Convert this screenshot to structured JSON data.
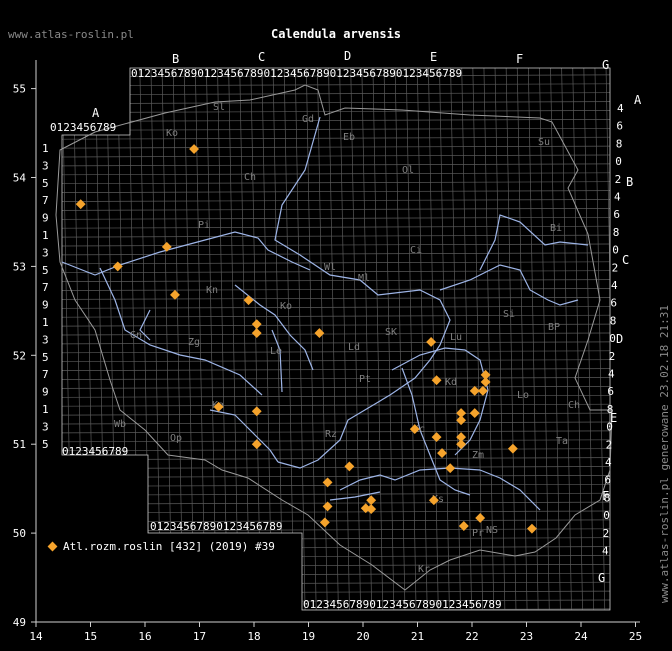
{
  "site": "www.atlas-roslin.pl",
  "title": "Calendula arvensis",
  "credit": "www.atlas-roslin.pl generowane 23.02.18 21:31",
  "legend_label": "Atl.rozm.roslin [432] (2019) #39",
  "colors": {
    "background": "#000000",
    "grid": "#5a5a5a",
    "border": "#9a9a9a",
    "rivers": "#9db4e6",
    "points": "#f5a32c",
    "text": "#ffffff"
  },
  "axes": {
    "x_ticks": [
      "14",
      "15",
      "16",
      "17",
      "18",
      "19",
      "20",
      "21",
      "22",
      "23",
      "24",
      "25"
    ],
    "y_ticks": [
      "49",
      "50",
      "51",
      "52",
      "53",
      "54",
      "55"
    ]
  },
  "grid_letters_top": [
    "A",
    "B",
    "C",
    "D",
    "E",
    "F",
    "G"
  ],
  "grid_letters_right": [
    "A",
    "B",
    "C",
    "D",
    "E",
    "F",
    "G"
  ],
  "grid_digits": "0123456789",
  "region_labels": [
    "Sl",
    "Gd",
    "Eb",
    "Ko",
    "Su",
    "Ol",
    "Ch",
    "Pi",
    "Bi",
    "Ci",
    "Wl",
    "Ml",
    "Kn",
    "Ko",
    "Gn",
    "Zg",
    "Le",
    "Lu",
    "Pt",
    "SK",
    "Ld",
    "Si",
    "BP",
    "Lo",
    "Ch",
    "Wb",
    "Op",
    "Ka",
    "Kc",
    "Kd",
    "Zm",
    "Ta",
    "Ks",
    "Rz",
    "NS",
    "Kr",
    "Pr"
  ],
  "chart_data": {
    "type": "scatter",
    "series": [
      {
        "name": "Atl.rozm.roslin [432] (2019) #39",
        "points": [
          [
            16.9,
            54.32
          ],
          [
            14.82,
            53.7
          ],
          [
            16.4,
            53.22
          ],
          [
            15.5,
            53.0
          ],
          [
            16.55,
            52.68
          ],
          [
            17.9,
            52.62
          ],
          [
            18.05,
            52.35
          ],
          [
            18.05,
            52.25
          ],
          [
            19.2,
            52.25
          ],
          [
            21.25,
            52.15
          ],
          [
            21.35,
            51.72
          ],
          [
            22.25,
            51.78
          ],
          [
            22.25,
            51.7
          ],
          [
            22.2,
            51.6
          ],
          [
            22.05,
            51.6
          ],
          [
            17.35,
            51.42
          ],
          [
            18.05,
            51.37
          ],
          [
            21.8,
            51.35
          ],
          [
            21.8,
            51.27
          ],
          [
            22.05,
            51.35
          ],
          [
            20.95,
            51.17
          ],
          [
            21.35,
            51.08
          ],
          [
            21.8,
            51.08
          ],
          [
            21.8,
            51.0
          ],
          [
            21.45,
            50.9
          ],
          [
            18.05,
            51.0
          ],
          [
            22.75,
            50.95
          ],
          [
            19.75,
            50.75
          ],
          [
            21.6,
            50.73
          ],
          [
            19.35,
            50.57
          ],
          [
            21.3,
            50.37
          ],
          [
            20.15,
            50.37
          ],
          [
            19.35,
            50.3
          ],
          [
            20.05,
            50.28
          ],
          [
            20.15,
            50.27
          ],
          [
            22.15,
            50.17
          ],
          [
            19.3,
            50.12
          ],
          [
            21.85,
            50.08
          ],
          [
            23.1,
            50.05
          ]
        ]
      }
    ],
    "xlim": [
      14,
      25
    ],
    "ylim": [
      49,
      55.25
    ]
  }
}
